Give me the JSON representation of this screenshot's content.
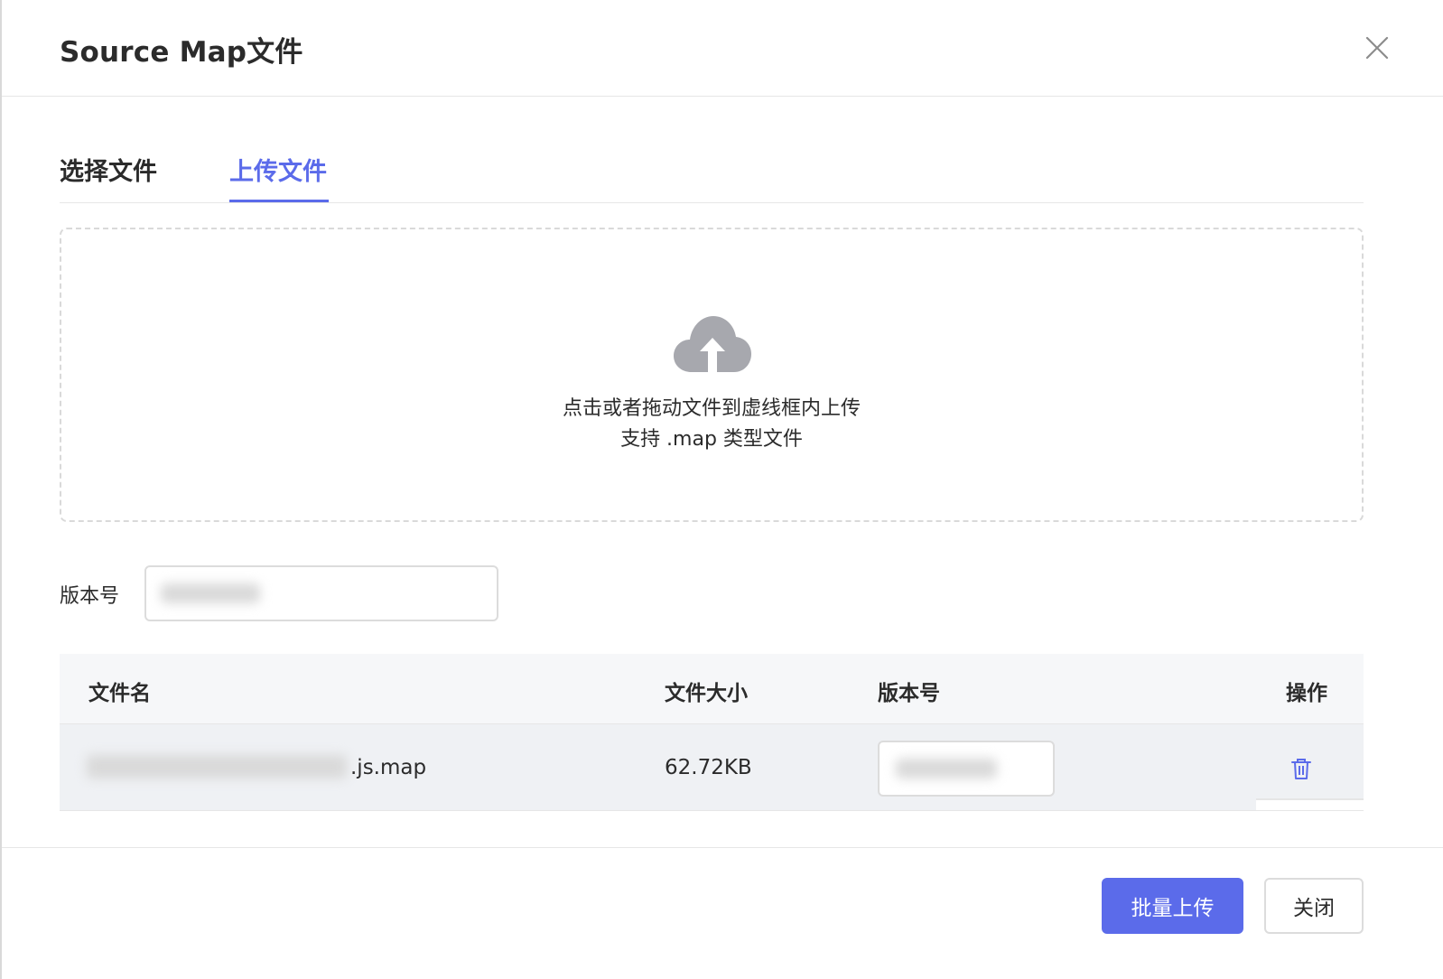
{
  "dialog": {
    "title": "Source Map文件"
  },
  "tabs": [
    {
      "label": "选择文件",
      "active": false
    },
    {
      "label": "上传文件",
      "active": true
    }
  ],
  "dropzone": {
    "icon": "cloud-upload-icon",
    "line1": "点击或者拖动文件到虚线框内上传",
    "line2": "支持 .map 类型文件"
  },
  "version": {
    "label": "版本号"
  },
  "table": {
    "headers": [
      "文件名",
      "文件大小",
      "版本号",
      "操作"
    ],
    "rows": [
      {
        "filename_suffix": ".js.map",
        "size": "62.72KB"
      }
    ]
  },
  "footer": {
    "upload_label": "批量上传",
    "close_label": "关闭"
  },
  "colors": {
    "accent": "#5b6bea",
    "text": "#2b2b2b",
    "border": "#dcdcdc"
  }
}
